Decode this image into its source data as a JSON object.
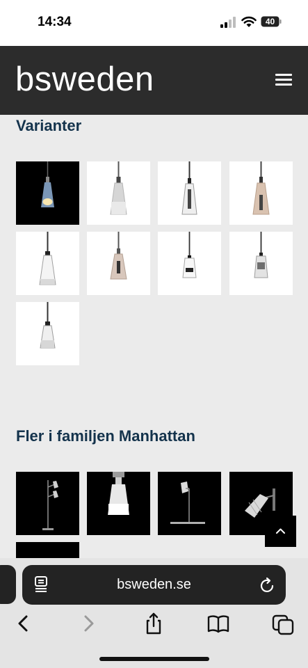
{
  "status_bar": {
    "time": "14:34",
    "battery": "40"
  },
  "header": {
    "logo": "bsweden",
    "menu_icon": "hamburger-icon"
  },
  "variants": {
    "title": "Varianter",
    "items": [
      "variant-1",
      "variant-2",
      "variant-3",
      "variant-4",
      "variant-5",
      "variant-6",
      "variant-7",
      "variant-8",
      "variant-9"
    ]
  },
  "family": {
    "title": "Fler i familjen Manhattan",
    "items": [
      "floor-lamp",
      "pendant-lamp",
      "table-lamp",
      "wall-lamp",
      "more-product"
    ]
  },
  "scroll_top": {
    "icon": "chevron-up-icon"
  },
  "browser": {
    "url": "bsweden.se",
    "tab_icon": "page-menu-icon",
    "reload_icon": "reload-icon",
    "toolbar": [
      "back-icon",
      "forward-icon",
      "share-icon",
      "bookmarks-icon",
      "tabs-icon"
    ]
  }
}
